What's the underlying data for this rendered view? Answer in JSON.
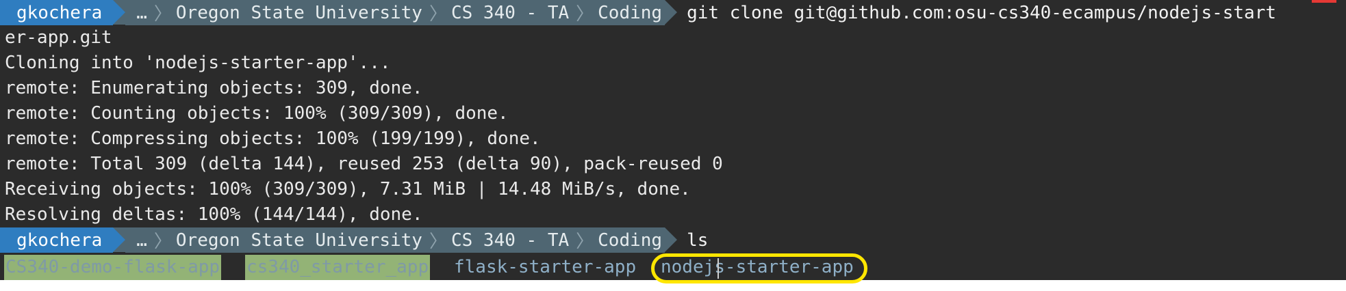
{
  "prompt": {
    "user": "gkochera",
    "ellipsis": "…",
    "path": [
      "Oregon State University",
      "CS 340 - TA",
      "Coding"
    ],
    "separator": "〉"
  },
  "commands": {
    "first": "git clone git@github.com:osu-cs340-ecampus/nodejs-start",
    "second": "ls"
  },
  "output": [
    "er-app.git",
    "Cloning into 'nodejs-starter-app'...",
    "remote: Enumerating objects: 309, done.",
    "remote: Counting objects: 100% (309/309), done.",
    "remote: Compressing objects: 100% (199/199), done.",
    "remote: Total 309 (delta 144), reused 253 (delta 90), pack-reused 0",
    "Receiving objects: 100% (309/309), 7.31 MiB | 14.48 MiB/s, done.",
    "Resolving deltas: 100% (144/144), done."
  ],
  "ls": {
    "items": [
      "CS340-demo-flask-app",
      "cs340_starter_app",
      "flask-starter-app",
      "nodejs-starter-app"
    ]
  },
  "colors": {
    "background": "#2b2b2b",
    "user_segment": "#2f7dc0",
    "path_segment": "#4f6672",
    "highlight": "#93b376",
    "annotation": "#ffe600"
  }
}
